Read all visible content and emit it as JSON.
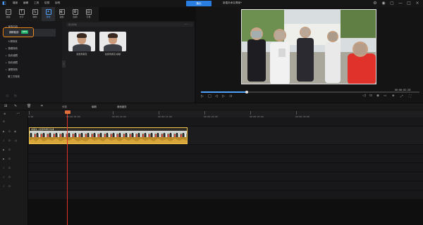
{
  "titlebar": {
    "menu": [
      "檔案",
      "編輯",
      "工具",
      "檢視",
      "說明"
    ],
    "export_label": "匯出",
    "project_title": "新建未命名專案*"
  },
  "tooltabs": [
    {
      "label": "媒體",
      "icon": "folder-icon",
      "glyph": "▭"
    },
    {
      "label": "文字",
      "icon": "text-icon",
      "glyph": "T"
    },
    {
      "label": "轉場",
      "icon": "transition-icon",
      "glyph": "⇆"
    },
    {
      "label": "特效",
      "icon": "effects-icon",
      "glyph": "✦"
    },
    {
      "label": "濾鏡",
      "icon": "filter-icon",
      "glyph": "◐"
    },
    {
      "label": "貼圖",
      "icon": "sticker-icon",
      "glyph": "✿"
    },
    {
      "label": "字幕",
      "icon": "subtitle-icon",
      "glyph": "▤"
    }
  ],
  "active_tab_index": 3,
  "leftpanel": {
    "items": [
      {
        "label": "我的內容",
        "expandable": true
      },
      {
        "label": "人物特效",
        "expandable": false
      },
      {
        "label": "基礎特效",
        "expandable": true
      },
      {
        "label": "色彩濾鏡",
        "expandable": true
      },
      {
        "label": "色彩濾鏡",
        "expandable": true
      },
      {
        "label": "畫框特效",
        "expandable": true
      },
      {
        "label": "第三方特效",
        "expandable": false
      }
    ],
    "selected_label": "調節臉部",
    "selected_badge": "NEW"
  },
  "media": {
    "search_placeholder": "搜尋特效",
    "more_glyph": "···",
    "thumbnails": [
      {
        "label": "臉部馬賽克"
      },
      {
        "label": "臉部馬賽克-模糊"
      }
    ]
  },
  "preview": {
    "timecode": "00:00:02:28",
    "progress": 0.21
  },
  "toolbar": {
    "labels": [
      "分割",
      "編輯",
      "畫面縮放"
    ]
  },
  "ruler": {
    "ticks": [
      "0:00",
      "00:00:05:00",
      "00:00:10:00",
      "00:00:15:00",
      "00:00:20:00",
      "00:00:25:00",
      "00:00:30:00"
    ]
  },
  "clip": {
    "title": "畫面加上臉部馬賽克效果",
    "color": "#f0c14a"
  },
  "colors": {
    "accent": "#4ea1ff",
    "export": "#2a7de1",
    "highlight_box": "#f08a1c",
    "playhead": "#e0312b",
    "badge": "#1fb36a"
  }
}
